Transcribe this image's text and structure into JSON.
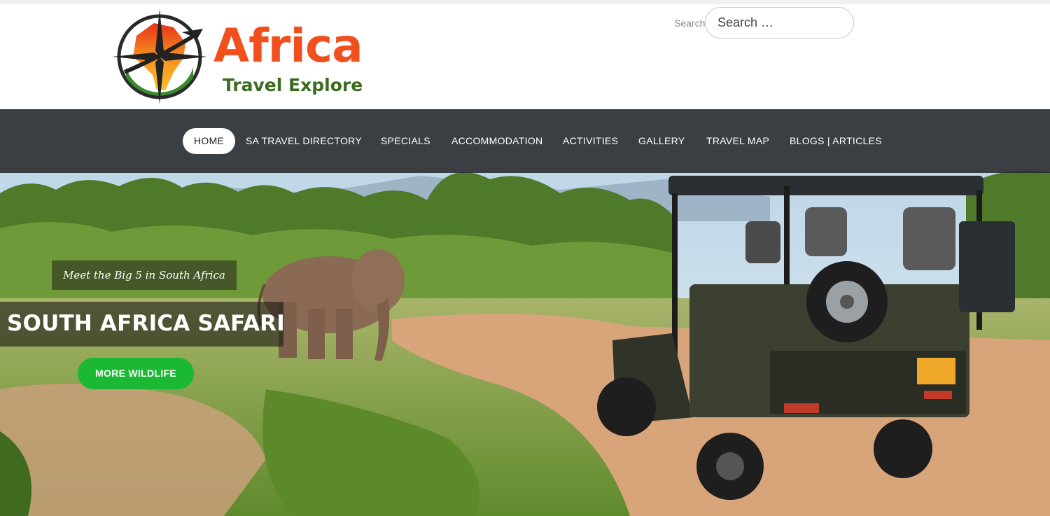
{
  "brand": {
    "name_line1": "Africa",
    "name_line2": "Travel Explore",
    "colors": {
      "orange": "#f0501e",
      "green": "#3a6b1e"
    }
  },
  "search": {
    "label": "Search",
    "placeholder": "Search …"
  },
  "nav": {
    "items": [
      {
        "label": "HOME",
        "active": true
      },
      {
        "label": "SA TRAVEL DIRECTORY",
        "active": false
      },
      {
        "label": "SPECIALS",
        "active": false
      },
      {
        "label": "ACCOMMODATION",
        "active": false
      },
      {
        "label": "ACTIVITIES",
        "active": false
      },
      {
        "label": "GALLERY",
        "active": false
      },
      {
        "label": "TRAVEL MAP",
        "active": false
      },
      {
        "label": "BLOGS | ARTICLES",
        "active": false
      }
    ]
  },
  "hero": {
    "tagline": "Meet the Big 5 in South Africa",
    "title": "SOUTH AFRICA SAFARI",
    "cta_label": "MORE WILDLIFE",
    "cta_color": "#1ab833"
  }
}
